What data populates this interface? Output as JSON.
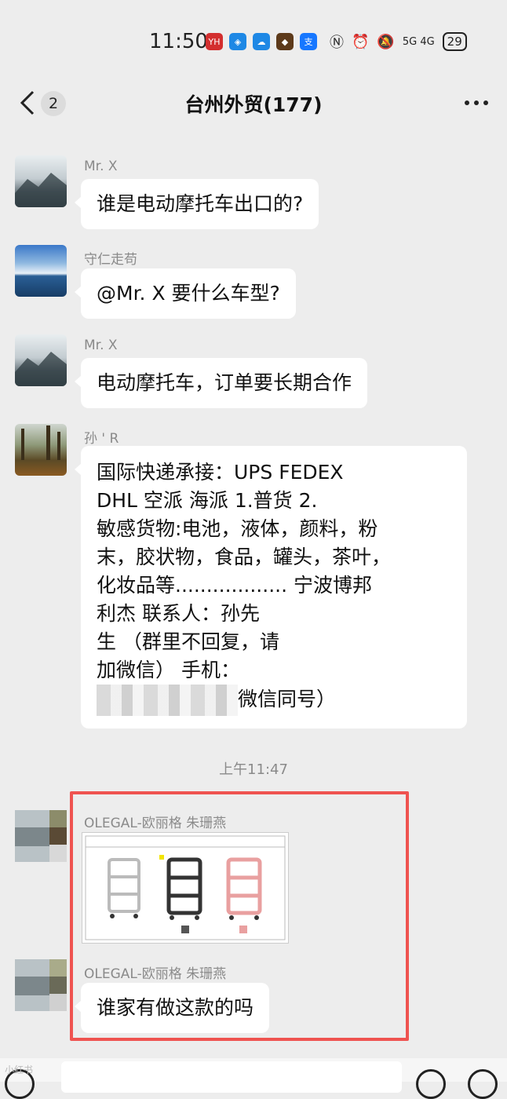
{
  "status": {
    "time": "11:50",
    "app_icons": [
      {
        "name": "app-icon-1",
        "color": "#d32f2f",
        "glyph": "YH"
      },
      {
        "name": "app-icon-2",
        "color": "#1e88e5",
        "glyph": "◈"
      },
      {
        "name": "app-icon-3",
        "color": "#1e88e5",
        "glyph": "☁"
      },
      {
        "name": "app-icon-4",
        "color": "#5d3a1a",
        "glyph": "◆"
      },
      {
        "name": "app-icon-5",
        "color": "#1677ff",
        "glyph": "支"
      }
    ],
    "network": "5G 4G",
    "battery": "29"
  },
  "nav": {
    "back_badge": "2",
    "title": "台州外贸(177)"
  },
  "messages": [
    {
      "sender": "Mr. X",
      "text": "谁是电动摩托车出口的?"
    },
    {
      "sender": "守仁走苟",
      "text": "@Mr. X 要什么车型?"
    },
    {
      "sender": "Mr. X",
      "text": "电动摩托车，订单要长期合作"
    },
    {
      "sender": "孙 ' R",
      "text_lines": [
        "国际快递承接：UPS FEDEX",
        "DHL 空派 海派 1.普货 2.",
        "敏感货物:电池，液体，颜料，粉",
        "末，胶状物，食品，罐头，茶叶，",
        "化妆品等.................. 宁波博邦",
        "利杰 联系人：孙先",
        "生 （群里不回复，请",
        "加微信） 手机："
      ],
      "text_tail": "微信同号）"
    }
  ],
  "timestamp": "上午11:47",
  "highlighted": [
    {
      "sender": "OLEGAL-欧丽格 朱珊燕",
      "type": "image",
      "image_desc": "three-tier-cart-product-sheet"
    },
    {
      "sender": "OLEGAL-欧丽格 朱珊燕",
      "text": "谁家有做这款的吗"
    }
  ],
  "watermark": "小红书"
}
